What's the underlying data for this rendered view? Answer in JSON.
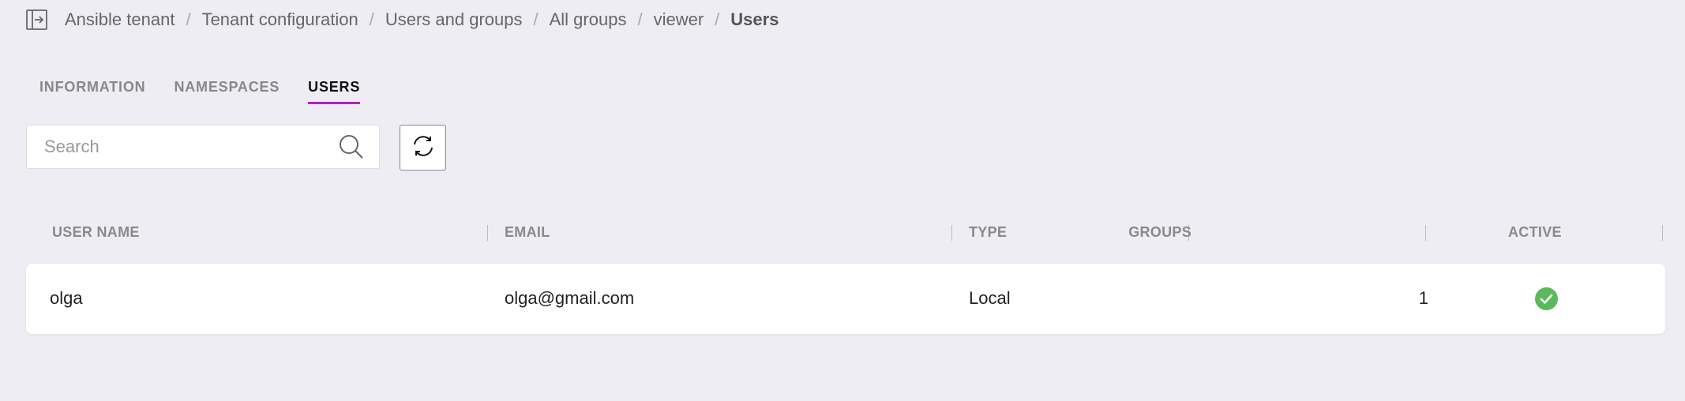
{
  "breadcrumb": {
    "items": [
      "Ansible tenant",
      "Tenant configuration",
      "Users and groups",
      "All groups",
      "viewer",
      "Users"
    ],
    "separator": "/"
  },
  "tabs": [
    {
      "label": "INFORMATION",
      "active": false
    },
    {
      "label": "NAMESPACES",
      "active": false
    },
    {
      "label": "USERS",
      "active": true
    }
  ],
  "search": {
    "placeholder": "Search",
    "value": ""
  },
  "table": {
    "columns": [
      "USER NAME",
      "EMAIL",
      "TYPE",
      "GROUPS",
      "ACTIVE"
    ],
    "rows": [
      {
        "user_name": "olga",
        "email": "olga@gmail.com",
        "type": "Local",
        "groups": "1",
        "active": true
      }
    ]
  },
  "colors": {
    "accent": "#b21fc8",
    "active_check": "#5cb85c",
    "background": "#eeedf3"
  },
  "icons": {
    "exit": "exit-sidebar-icon",
    "search": "search-icon",
    "refresh": "refresh-icon",
    "active": "check-circle-icon"
  }
}
